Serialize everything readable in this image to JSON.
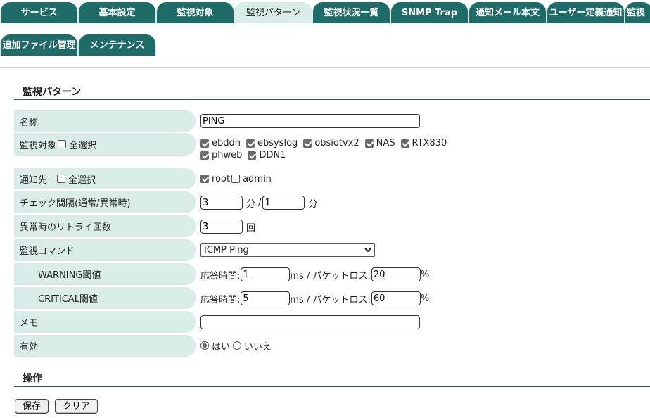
{
  "tabs": [
    {
      "label": "サービス",
      "active": false
    },
    {
      "label": "基本設定",
      "active": false
    },
    {
      "label": "監視対象",
      "active": false
    },
    {
      "label": "監視パターン",
      "active": true
    },
    {
      "label": "監視状況一覧",
      "active": false
    },
    {
      "label": "SNMP Trap",
      "active": false
    },
    {
      "label": "通知メール本文",
      "active": false
    },
    {
      "label": "ユーザー定義通知",
      "active": false
    },
    {
      "label": "監視",
      "active": false
    }
  ],
  "tabs2": [
    {
      "label": "追加ファイル管理"
    },
    {
      "label": "メンテナンス"
    }
  ],
  "section_title": "監視パターン",
  "form": {
    "name": {
      "label": "名称",
      "value": "PING"
    },
    "targets": {
      "label": "監視対象",
      "select_all": "全選択",
      "items": [
        "ebddn",
        "ebsyslog",
        "obsiotvx2",
        "NAS",
        "RTX830",
        "phweb",
        "DDN1"
      ]
    },
    "notify": {
      "label": "通知先",
      "select_all": "全選択",
      "items": [
        {
          "name": "root",
          "checked": true
        },
        {
          "name": "admin",
          "checked": false
        }
      ]
    },
    "interval": {
      "label": "チェック間隔(通常/異常時)",
      "normal": "3",
      "abnormal": "1",
      "unit": "分",
      "sep": "/"
    },
    "retry": {
      "label": "異常時のリトライ回数",
      "value": "3",
      "unit": "回"
    },
    "command": {
      "label": "監視コマンド",
      "value": "ICMP Ping"
    },
    "warning": {
      "label": "WARNING閾値",
      "rt_label": "応答時間:",
      "rt": "1",
      "ms_label": "ms / パケットロス:",
      "loss": "20",
      "pct": "%"
    },
    "critical": {
      "label": "CRITICAL閾値",
      "rt_label": "応答時間:",
      "rt": "5",
      "ms_label": "ms / パケットロス:",
      "loss": "60",
      "pct": "%"
    },
    "memo": {
      "label": "メモ",
      "value": ""
    },
    "enabled": {
      "label": "有効",
      "yes": "はい",
      "no": "いいえ",
      "selected": "yes"
    }
  },
  "ops_title": "操作",
  "buttons": {
    "save": "保存",
    "clear": "クリア"
  }
}
